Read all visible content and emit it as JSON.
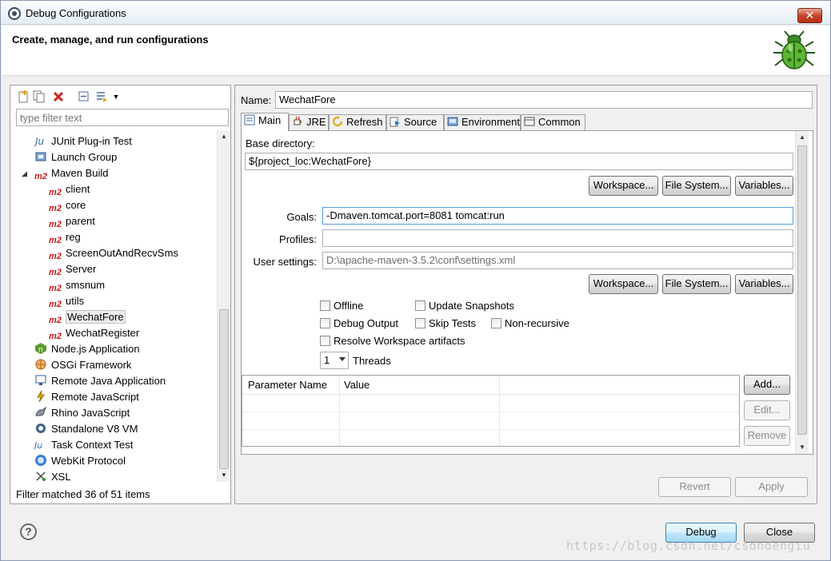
{
  "window": {
    "title": "Debug Configurations",
    "close_glyph": "✕"
  },
  "banner": {
    "title": "Create, manage, and run configurations",
    "icon": "bug-icon"
  },
  "left": {
    "toolbar_icons": [
      "new-configuration-icon",
      "duplicate-icon",
      "delete-icon",
      "collapse-all-icon",
      "filter-icon",
      "dropdown-icon"
    ],
    "filter_placeholder": "type filter text",
    "tree": [
      {
        "label": "JUnit Plug-in Test",
        "icon": "junit-plugin-icon",
        "level": 0
      },
      {
        "label": "Launch Group",
        "icon": "launch-group-icon",
        "level": 0
      },
      {
        "label": "Maven Build",
        "icon": "m2",
        "level": 0,
        "expanded": true
      },
      {
        "label": "client",
        "icon": "m2",
        "level": 1
      },
      {
        "label": "core",
        "icon": "m2",
        "level": 1
      },
      {
        "label": "parent",
        "icon": "m2",
        "level": 1
      },
      {
        "label": "reg",
        "icon": "m2",
        "level": 1
      },
      {
        "label": "ScreenOutAndRecvSms",
        "icon": "m2",
        "level": 1
      },
      {
        "label": "Server",
        "icon": "m2",
        "level": 1
      },
      {
        "label": "smsnum",
        "icon": "m2",
        "level": 1
      },
      {
        "label": "utils",
        "icon": "m2",
        "level": 1
      },
      {
        "label": "WechatFore",
        "icon": "m2",
        "level": 1,
        "selected": true
      },
      {
        "label": "WechatRegister",
        "icon": "m2",
        "level": 1
      },
      {
        "label": "Node.js Application",
        "icon": "nodejs-icon",
        "level": 0
      },
      {
        "label": "OSGi Framework",
        "icon": "osgi-icon",
        "level": 0
      },
      {
        "label": "Remote Java Application",
        "icon": "remote-java-icon",
        "level": 0
      },
      {
        "label": "Remote JavaScript",
        "icon": "remote-javascript-icon",
        "level": 0
      },
      {
        "label": "Rhino JavaScript",
        "icon": "rhino-icon",
        "level": 0
      },
      {
        "label": "Standalone V8 VM",
        "icon": "v8-icon",
        "level": 0
      },
      {
        "label": "Task Context Test",
        "icon": "task-context-icon",
        "level": 0
      },
      {
        "label": "WebKit Protocol",
        "icon": "webkit-icon",
        "level": 0
      },
      {
        "label": "XSL",
        "icon": "xsl-icon",
        "level": 0
      }
    ],
    "status": "Filter matched 36 of 51 items"
  },
  "right": {
    "name_label": "Name:",
    "name_value": "WechatFore",
    "tabs": [
      {
        "label": "Main",
        "icon": "main-tab-icon",
        "active": true
      },
      {
        "label": "JRE",
        "icon": "jre-icon"
      },
      {
        "label": "Refresh",
        "icon": "refresh-icon"
      },
      {
        "label": "Source",
        "icon": "source-icon"
      },
      {
        "label": "Environment",
        "icon": "environment-icon"
      },
      {
        "label": "Common",
        "icon": "common-icon"
      }
    ],
    "base_dir_label": "Base directory:",
    "base_dir_value": "${project_loc:WechatFore}",
    "workspace_btn": "Workspace...",
    "filesystem_btn": "File System...",
    "variables_btn": "Variables...",
    "goals_label": "Goals:",
    "goals_value": "-Dmaven.tomcat.port=8081 tomcat:run",
    "profiles_label": "Profiles:",
    "profiles_value": "",
    "user_settings_label": "User settings:",
    "user_settings_value": "D:\\apache-maven-3.5.2\\conf\\settings.xml",
    "checkboxes": {
      "offline": "Offline",
      "update_snapshots": "Update Snapshots",
      "debug_output": "Debug Output",
      "skip_tests": "Skip Tests",
      "non_recursive": "Non-recursive",
      "resolve_workspace": "Resolve Workspace artifacts"
    },
    "threads_value": "1",
    "threads_label": "Threads",
    "param_table": {
      "col_name": "Parameter Name",
      "col_value": "Value"
    },
    "add_btn": "Add...",
    "edit_btn": "Edit...",
    "remove_btn": "Remove",
    "revert_btn": "Revert",
    "apply_btn": "Apply"
  },
  "footer": {
    "help_glyph": "?",
    "debug_btn": "Debug",
    "close_btn": "Close",
    "watermark": "https://blog.csdn.net/csdndengiu"
  },
  "colors": {
    "m2_red": "#c4161c",
    "accent_blue": "#3c7fb1"
  }
}
